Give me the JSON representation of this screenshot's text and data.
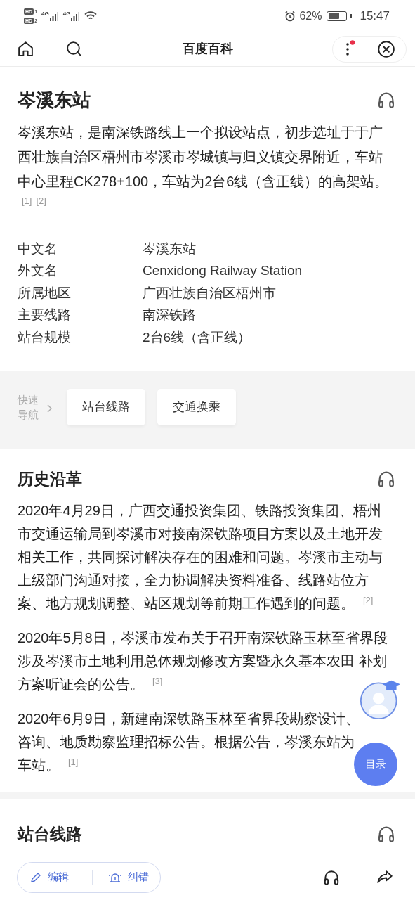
{
  "status_bar": {
    "sims": [
      {
        "label": "HD",
        "slot": "1"
      },
      {
        "label": "HD",
        "slot": "2"
      }
    ],
    "networks": [
      "4G",
      "4G"
    ],
    "battery": "62%",
    "time": "15:47"
  },
  "header": {
    "title": "百度百科",
    "menu_badge": true
  },
  "article": {
    "title": "岑溪东站",
    "summary_lines": [
      "岑溪东站，是南深铁路线上一个拟设站点，初步选址于于广",
      "西壮族自治区梧州市岑溪市岑城镇与归义镇交界附近，车站",
      "中心里程CK278+100，车站为2台6线（含正线）的高架站。"
    ],
    "refs": [
      "[1]",
      "[2]"
    ]
  },
  "infobox": [
    {
      "label": "中文名",
      "value": "岑溪东站"
    },
    {
      "label": "外文名",
      "value": "Cenxidong Railway Station"
    },
    {
      "label": "所属地区",
      "value": "广西壮族自治区梧州市"
    },
    {
      "label": "主要线路",
      "value": "南深铁路"
    },
    {
      "label": "站台规模",
      "value": "2台6线（含正线）"
    }
  ],
  "quick_nav": {
    "label_lines": [
      "快速",
      "导航"
    ],
    "links": [
      "站台线路",
      "交通换乘"
    ]
  },
  "sections": [
    {
      "title": "历史沿革",
      "paragraphs": [
        {
          "lines": [
            "2020年4月29日，广西交通投资集团、铁路投资集团、梧州",
            "市交通运输局到岑溪市对接南深铁路项目方案以及土地开发",
            "相关工作，共同探讨解决存在的困难和问题。岑溪市主动与",
            "上级部门沟通对接，全力协调解决资料准备、线路站位方",
            "案、地方规划调整、站区规划等前期工作遇到的问题。"
          ],
          "ref": "[2]"
        },
        {
          "lines": [
            "2020年5月8日，岑溪市发布关于召开南深铁路玉林至省界段",
            "涉及岑溪市土地利用总体规划修改方案暨永久基本农田 补划",
            "方案听证会的公告。"
          ],
          "ref": "[3]"
        },
        {
          "lines": [
            "2020年6月9日，新建南深铁路玉林至省界段勘察设计、",
            "咨询、地质勘察监理招标公告。根据公告，岑溪东站为",
            "车站。"
          ],
          "ref": "[1]"
        }
      ]
    },
    {
      "title": "站台线路"
    }
  ],
  "floating": {
    "toc": "目录"
  },
  "bottom_bar": {
    "actions": [
      {
        "kind": "edit",
        "label": "编辑"
      },
      {
        "kind": "report",
        "label": "纠错"
      }
    ]
  }
}
